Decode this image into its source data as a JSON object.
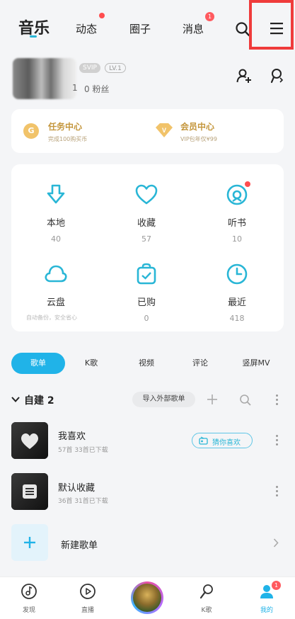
{
  "top_tabs": {
    "music": "音乐",
    "feed": "动态",
    "circle": "圈子",
    "messages": "消息",
    "messages_badge": "1"
  },
  "profile": {
    "vip_badge": "SVIP",
    "level_badge": "LV.1",
    "follow_stats": "1",
    "fans_stats": "0 粉丝"
  },
  "quick_cards": {
    "task_title": "任务中心",
    "task_sub": "完成100购买币",
    "task_icon_letter": "G",
    "vip_title": "会员中心",
    "vip_sub": "VIP包年仅¥99",
    "vip_icon_letter": "V"
  },
  "library": [
    {
      "label": "本地",
      "count": "40",
      "icon": "download-icon"
    },
    {
      "label": "收藏",
      "count": "57",
      "icon": "heart-icon"
    },
    {
      "label": "听书",
      "count": "10",
      "icon": "headphones-icon"
    },
    {
      "label": "云盘",
      "count": "自动备份，安全省心",
      "icon": "cloud-icon"
    },
    {
      "label": "已购",
      "count": "0",
      "icon": "purchased-bag-icon"
    },
    {
      "label": "最近",
      "count": "418",
      "icon": "clock-icon"
    }
  ],
  "segments": [
    "歌单",
    "K歌",
    "视频",
    "评论",
    "竖屏MV"
  ],
  "section": {
    "title": "自建 2",
    "import_label": "导入外部歌单"
  },
  "playlists": [
    {
      "name": "我喜欢",
      "meta": "57首  33首已下载",
      "action": "猜你喜欢"
    },
    {
      "name": "默认收藏",
      "meta": "36首  31首已下载"
    }
  ],
  "new_playlist_label": "新建歌单",
  "bottom_nav": {
    "discover": "发现",
    "live": "直播",
    "ksong": "K歌",
    "mine": "我的",
    "mine_badge": "1"
  },
  "colors": {
    "accent": "#20b3e8",
    "highlight": "#ef3b3b",
    "gold": "#c4963c"
  }
}
